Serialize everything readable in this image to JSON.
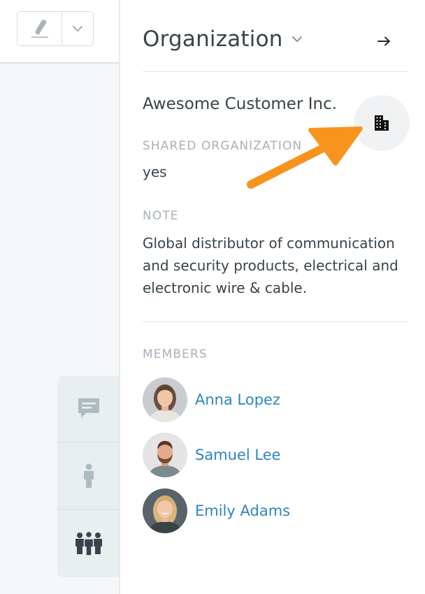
{
  "toolbar": {
    "edit_icon": "highlighter-icon",
    "dropdown_icon": "chevron-down-icon"
  },
  "sidebar_tabs": [
    {
      "icon": "chat-bubble-icon",
      "active": false
    },
    {
      "icon": "person-icon",
      "active": false
    },
    {
      "icon": "group-icon",
      "active": true
    }
  ],
  "panel": {
    "title": "Organization",
    "title_icon": "chevron-down-icon",
    "close_icon": "arrow-right-icon"
  },
  "organization": {
    "name": "Awesome Customer Inc.",
    "avatar_icon": "building-icon",
    "shared_label": "Shared organization",
    "shared_value": "yes",
    "note_label": "Note",
    "note_value": "Global distributor of communication and security products, electrical and electronic wire & cable."
  },
  "members": {
    "label": "Members",
    "items": [
      {
        "name": "Anna Lopez"
      },
      {
        "name": "Samuel Lee"
      },
      {
        "name": "Emily Adams"
      }
    ]
  },
  "colors": {
    "link": "#2d86c3",
    "label": "#a7b1b9",
    "text": "#38434b",
    "callout": "#f7941e"
  }
}
